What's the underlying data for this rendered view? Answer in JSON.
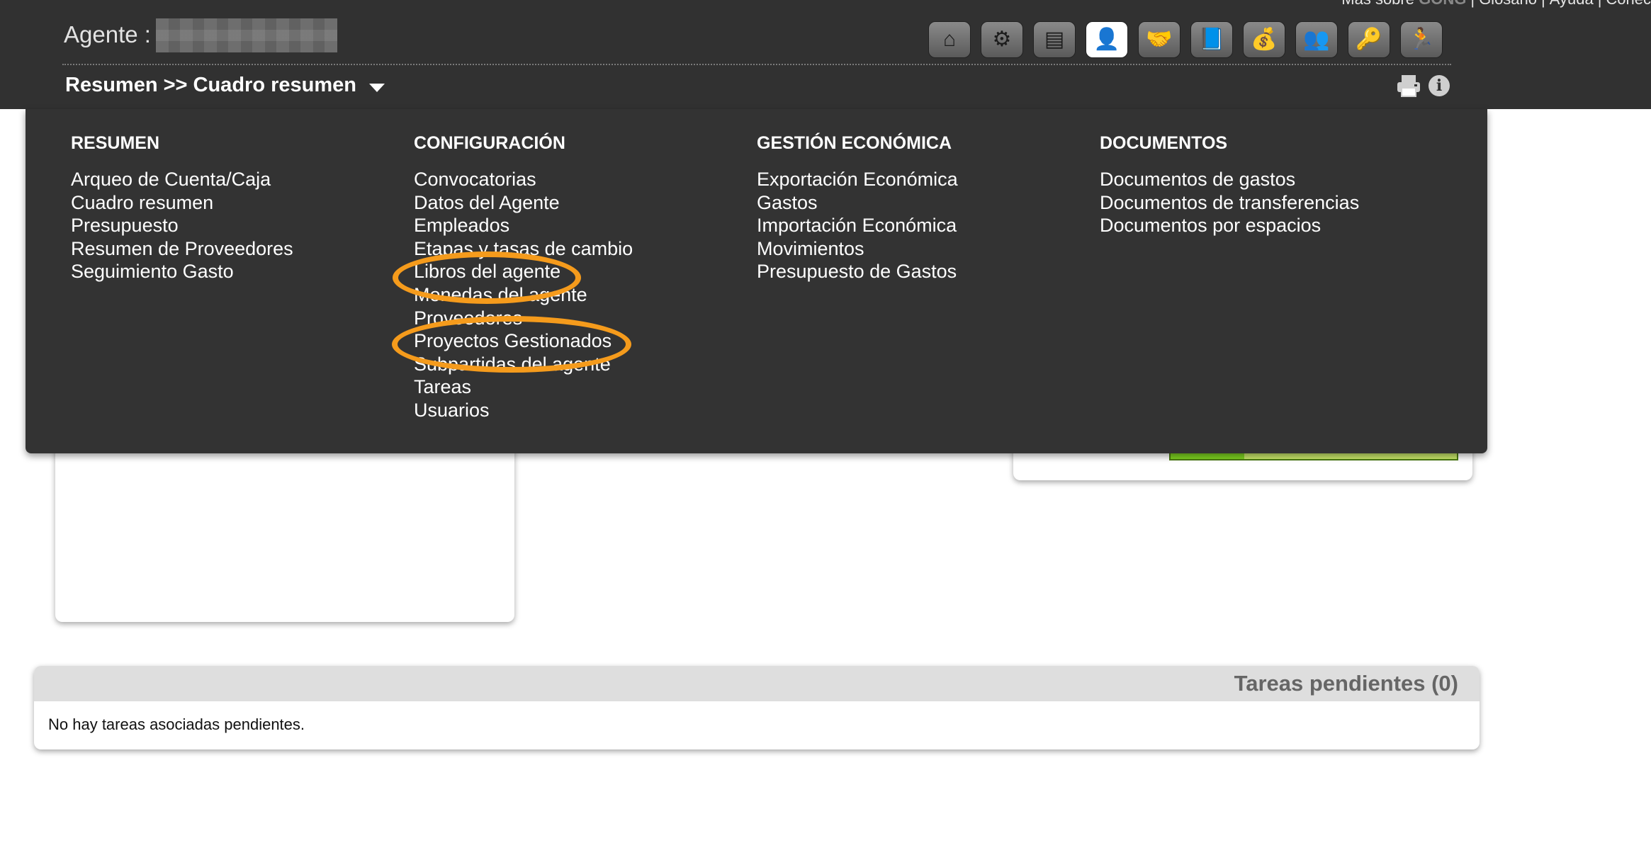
{
  "top_links": [
    {
      "label": "Más sobre",
      "brand": "GONG"
    },
    {
      "label": "Glosario"
    },
    {
      "label": "Ayuda"
    },
    {
      "label": "Conec"
    }
  ],
  "header": {
    "agent_label": "Agente :",
    "breadcrumb": "Resumen >> Cuadro resumen"
  },
  "icons": [
    {
      "name": "home-icon",
      "glyph": "⌂",
      "active": false
    },
    {
      "name": "users-settings-icon",
      "glyph": "⚙",
      "active": false
    },
    {
      "name": "database-icon",
      "glyph": "▤",
      "active": false
    },
    {
      "name": "user-icon",
      "glyph": "👤",
      "active": true
    },
    {
      "name": "handshake-icon",
      "glyph": "🤝",
      "active": false
    },
    {
      "name": "book-icon",
      "glyph": "📘",
      "active": false
    },
    {
      "name": "money-bag-icon",
      "glyph": "💰",
      "active": false
    },
    {
      "name": "group-icon",
      "glyph": "👥",
      "active": false
    },
    {
      "name": "key-icon",
      "glyph": "🔑",
      "active": false
    },
    {
      "name": "exit-icon",
      "glyph": "🏃",
      "active": false
    }
  ],
  "menu": {
    "resumen": {
      "title": "RESUMEN",
      "items": [
        "Arqueo de Cuenta/Caja",
        "Cuadro resumen",
        "Presupuesto",
        "Resumen de Proveedores",
        "Seguimiento Gasto"
      ]
    },
    "configuracion": {
      "title": "CONFIGURACIÓN",
      "items": [
        "Convocatorias",
        "Datos del Agente",
        "Empleados",
        "Etapas y tasas de cambio",
        "Libros del agente",
        "Monedas del agente",
        "Proveedores",
        "Proyectos Gestionados",
        "Subpartidas del agente",
        "Tareas",
        "Usuarios"
      ]
    },
    "gestion": {
      "title": "GESTIÓN ECONÓMICA",
      "items": [
        "Exportación Económica",
        "Gastos",
        "Importación Económica",
        "Movimientos",
        "Presupuesto de Gastos"
      ]
    },
    "documentos": {
      "title": "DOCUMENTOS",
      "items": [
        "Documentos de gastos",
        "Documentos de transferencias",
        "Documentos por espacios"
      ]
    }
  },
  "tasks": {
    "header": "Tareas pendientes (0)",
    "empty_message": "No hay tareas asociadas pendientes."
  },
  "annotation_color": "#f59b1c"
}
